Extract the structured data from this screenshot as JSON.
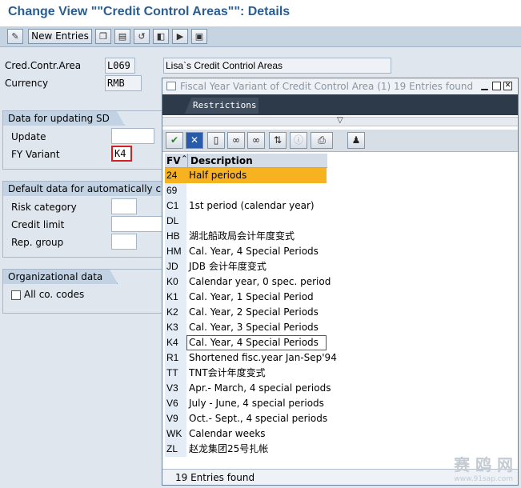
{
  "window": {
    "title": "Change View \"\"Credit Control Areas\"\": Details"
  },
  "toolbar": {
    "new_entries_label": "New Entries"
  },
  "header": {
    "cca_label": "Cred.Contr.Area",
    "cca_value": "L069",
    "cca_description": "Lisa`s Credit Contriol Areas",
    "currency_label": "Currency",
    "currency_value": "RMB"
  },
  "sd_group": {
    "title": "Data for updating SD",
    "update_label": "Update",
    "update_value": "",
    "fy_variant_label": "FY Variant",
    "fy_variant_value": "K4"
  },
  "default_group": {
    "title": "Default data for automatically creat",
    "risk_label": "Risk category",
    "credit_label": "Credit limit",
    "rep_label": "Rep. group"
  },
  "org_group": {
    "title": "Organizational data",
    "all_codes_label": "All co. codes"
  },
  "popup": {
    "title": "Fiscal Year Variant of Credit Control Area (1)   19 Entries found",
    "restrictions_tab": "Restrictions",
    "col_fv": "FV",
    "col_desc": "Description",
    "status": "19 Entries found",
    "rows": [
      {
        "fv": "24",
        "desc": "Half periods"
      },
      {
        "fv": "69",
        "desc": ""
      },
      {
        "fv": "C1",
        "desc": "1st period (calendar year)"
      },
      {
        "fv": "DL",
        "desc": ""
      },
      {
        "fv": "HB",
        "desc": "湖北船政局会计年度变式"
      },
      {
        "fv": "HM",
        "desc": "Cal. Year, 4 Special Periods"
      },
      {
        "fv": "JD",
        "desc": "JDB 会计年度变式"
      },
      {
        "fv": "K0",
        "desc": "Calendar year, 0 spec. period"
      },
      {
        "fv": "K1",
        "desc": "Cal. Year, 1 Special Period"
      },
      {
        "fv": "K2",
        "desc": "Cal. Year, 2 Special Periods"
      },
      {
        "fv": "K3",
        "desc": "Cal. Year, 3 Special Periods"
      },
      {
        "fv": "K4",
        "desc": "Cal. Year, 4 Special Periods"
      },
      {
        "fv": "R1",
        "desc": "Shortened fisc.year Jan-Sep'94"
      },
      {
        "fv": "TT",
        "desc": "TNT会计年度变式"
      },
      {
        "fv": "V3",
        "desc": "Apr.- March, 4 special periods"
      },
      {
        "fv": "V6",
        "desc": "July - June, 4 special periods"
      },
      {
        "fv": "V9",
        "desc": "Oct.- Sept., 4 special periods"
      },
      {
        "fv": "WK",
        "desc": "Calendar weeks"
      },
      {
        "fv": "ZL",
        "desc": "赵龙集团25号扎帐"
      }
    ]
  },
  "watermark": {
    "text": "赛 鸥 网",
    "url": "www.91sap.com"
  },
  "colors": {
    "title": "#2a5e92",
    "selected_row": "#f6b31f",
    "highlight_border": "#d42020"
  }
}
